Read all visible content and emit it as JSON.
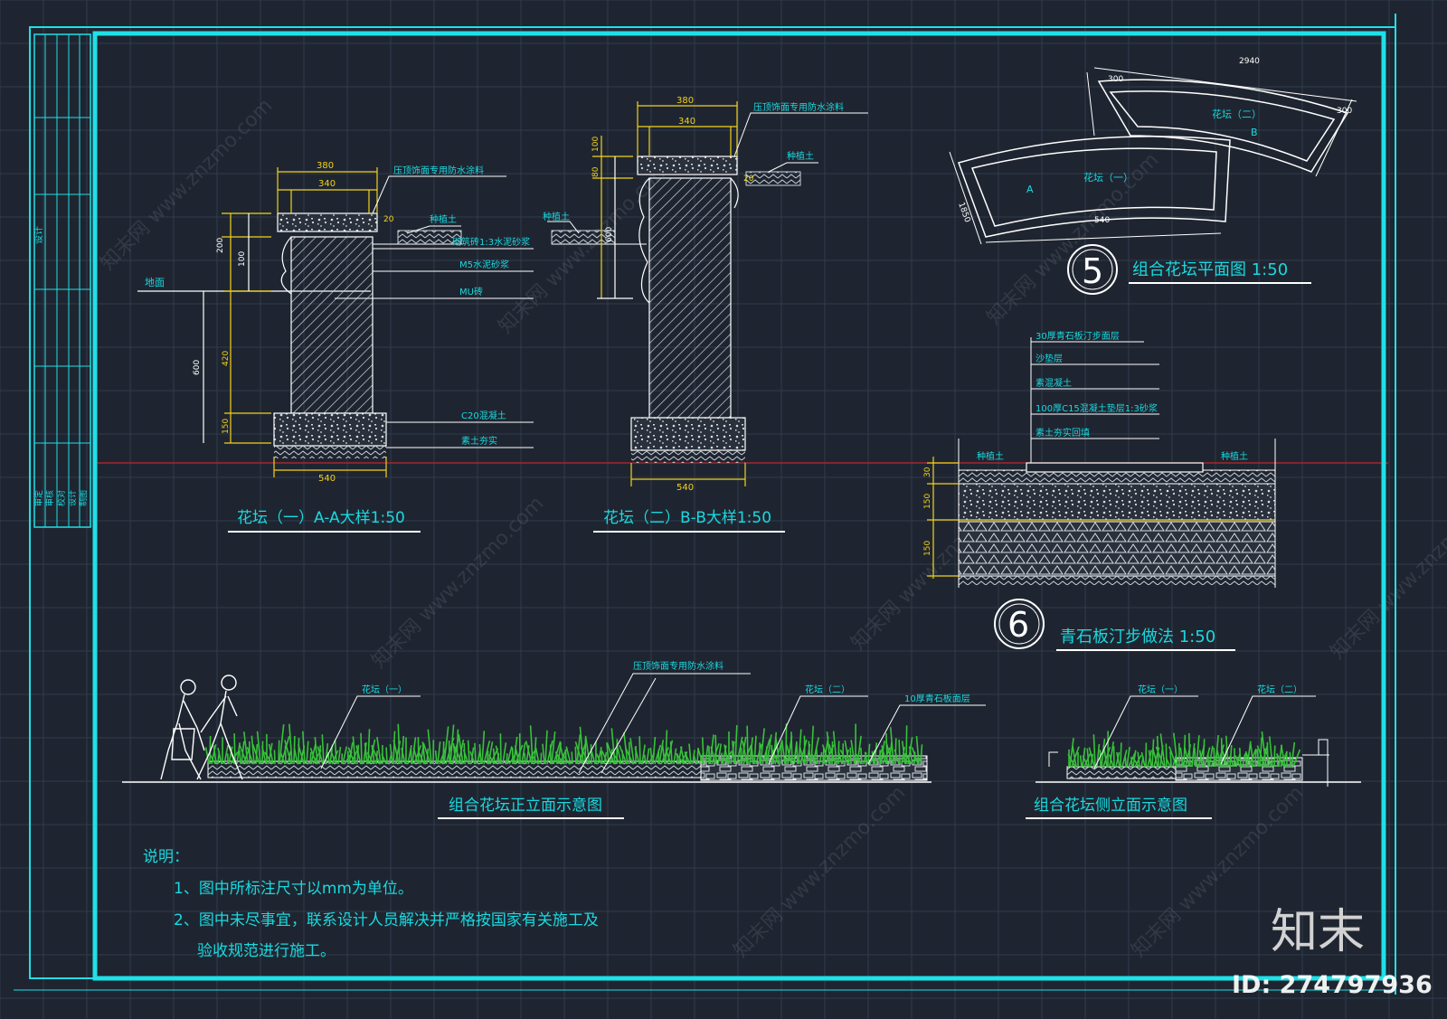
{
  "colors": {
    "background": "#1f2530",
    "grid": "#2f3b4e",
    "frame": "#1fe0e6",
    "hatch": "#c9d2da",
    "dimension": "#f2d21b",
    "leader": "#ffffff",
    "text": "#19d9e0",
    "plants": "#37c23a",
    "redline": "#c0262b",
    "watermark": "#9aa3b2"
  },
  "title_block": {
    "top_label": "设计",
    "bottom_labels": [
      "审定",
      "审核",
      "校对",
      "设计",
      "制图"
    ]
  },
  "section_a": {
    "title": "花坛（一）A-A大样1:50",
    "dims_top": [
      "380",
      "340",
      "20"
    ],
    "dims_left": [
      "200",
      "100",
      "600",
      "420",
      "150"
    ],
    "dim_bottom": "540",
    "labels": [
      "压顶饰面专用防水涂料",
      "种植土",
      "砌筑砖1:3水泥砂浆",
      "M5水泥砂浆",
      "MU砖",
      "C20混凝土",
      "素土夯实"
    ],
    "ground_label": "地面"
  },
  "section_b": {
    "title": "花坛（二）B-B大样1:50",
    "dims_top": [
      "380",
      "340",
      "20"
    ],
    "dims_left": [
      "100",
      "80",
      "600"
    ],
    "dim_bottom": "540",
    "labels": [
      "压顶饰面专用防水涂料",
      "种植土",
      "种植土"
    ]
  },
  "plan": {
    "number": "5",
    "title": "组合花坛平面图 1:50",
    "labels": [
      "花坛（一）",
      "花坛（二）",
      "A",
      "B"
    ],
    "dims": [
      "300",
      "1850",
      "2940",
      "540",
      "300"
    ]
  },
  "paving": {
    "number": "6",
    "title": "青石板汀步做法 1:50",
    "layers": [
      "30厚青石板汀步面层",
      "沙垫层",
      "素混凝土",
      "100厚C15混凝土垫层1:3砂浆",
      "素土夯实回填"
    ],
    "side_labels": [
      "种植土",
      "种植土"
    ],
    "dims": [
      "30",
      "150",
      "150"
    ]
  },
  "front_elevation": {
    "title": "组合花坛正立面示意图",
    "labels": [
      "花坛（一）",
      "压顶饰面专用防水涂料",
      "花坛（二）",
      "10厚青石板面层"
    ]
  },
  "side_elevation": {
    "title": "组合花坛侧立面示意图",
    "labels": [
      "花坛（一）",
      "花坛（二）"
    ]
  },
  "notes": {
    "heading": "说明：",
    "lines": [
      "1、图中所标注尺寸以mm为单位。",
      "2、图中未尽事宜，联系设计人员解决并严格按国家有关施工及",
      "验收规范进行施工。"
    ]
  },
  "logo": {
    "text": "知末",
    "id": "ID: 274797936",
    "watermark": "知末网 www.znzmo.com"
  }
}
